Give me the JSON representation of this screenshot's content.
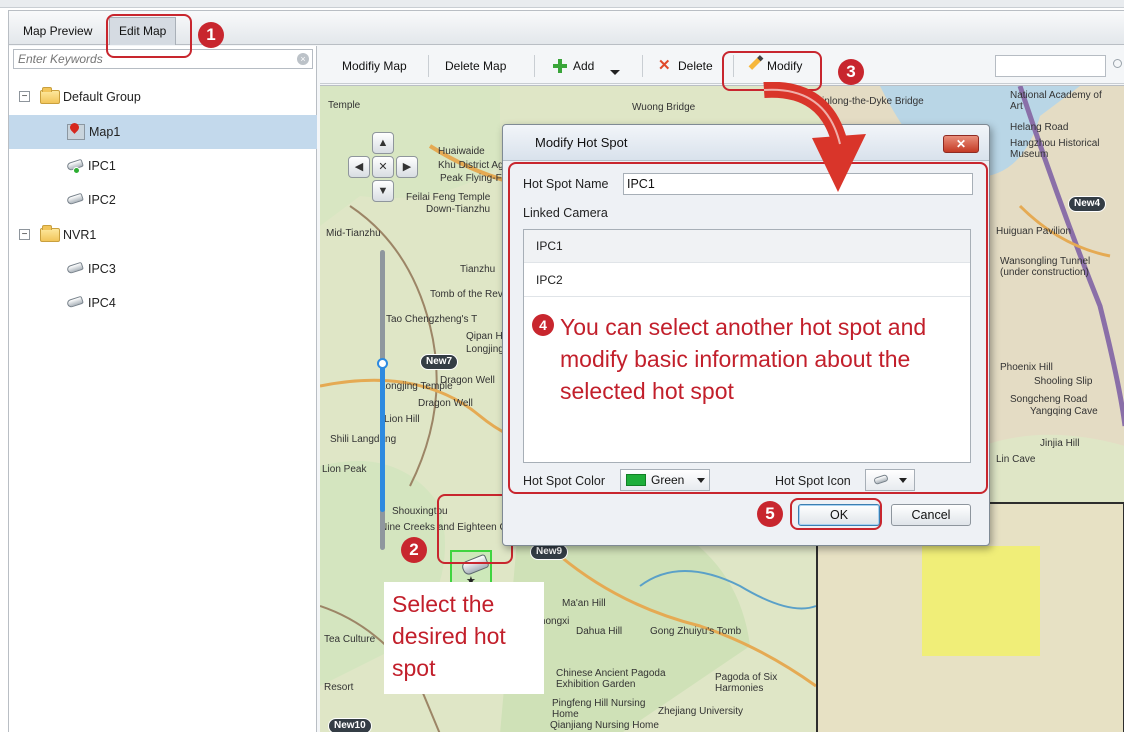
{
  "tabs": {
    "preview_label": "Map Preview",
    "edit_label": "Edit Map"
  },
  "search": {
    "placeholder": "Enter Keywords"
  },
  "tree": {
    "group_label": "Default Group",
    "map_label": "Map1",
    "ipc1_label": "IPC1",
    "ipc2_label": "IPC2",
    "nvr_label": "NVR1",
    "ipc3_label": "IPC3",
    "ipc4_label": "IPC4"
  },
  "toolbar": {
    "modify_map_label": "Modifiy Map",
    "delete_map_label": "Delete Map",
    "add_label": "Add",
    "delete_label": "Delete",
    "modify_label": "Modify"
  },
  "map": {
    "new_tag_1": "New7",
    "new_tag_2": "New9",
    "new_tag_3": "New4",
    "new_tag_4": "New10",
    "labels": {
      "l1": "Temple",
      "l2": "Wuong Bridge",
      "l3": "Jinlong-the-Dyke Bridge",
      "l4": "Huaiwaide",
      "l5": "Khu District Ag",
      "l6": "Peak Flying-F",
      "l7": "Feilai Feng Temple",
      "l8": "Down-Tianzhu",
      "l9": "Mid-Tianzhu",
      "l10": "Tianzhu",
      "l11": "Tomb of the Revolution M",
      "l12": "Tao Chengzheng's T",
      "l13": "Qipan H",
      "l14": "Longjing",
      "l15": "Longjing Temple",
      "l16": "Dragon Well",
      "l17": "Lion Hill",
      "l18": "Dragon Well",
      "l19": "Shili Langdang",
      "l20": "Lion Peak",
      "l21": "Shouxingtou",
      "l22": "Nine Creeks and Eighteen Gullies",
      "l23": "Ma'an Hill",
      "l24": "Xizhongxi",
      "l25": "Dahua Hill",
      "l26": "Gong Zhuiyu's Tomb",
      "l27": "Chinese Ancient Pagoda Exhibition Garden",
      "l28": "Pagoda of Six Harmonies",
      "l29": "Pingfeng Hill Nursing Home",
      "l30": "Zhejiang University",
      "l31": "Qianjiang Nursing Home",
      "l32": "National Academy of Art",
      "l33": "Helang Road",
      "l34": "Hangzhou Historical Museum",
      "l35": "Huiguan Pavilion",
      "l36": "Wansongling Tunnel (under construction)",
      "l37": "Phoenix Hill",
      "l38": "Shooling Slip",
      "l39": "Songcheng Road",
      "l40": "Yangqing Cave",
      "l41": "Jinjia Hill",
      "l42": "Lin Cave",
      "l43": "Tea Culture",
      "l44": "Resort"
    }
  },
  "dialog": {
    "title": "Modify Hot Spot",
    "close_label": "✕",
    "name_label": "Hot Spot Name",
    "name_value": "IPC1",
    "linked_label": "Linked Camera",
    "cameras": [
      "IPC1",
      "IPC2"
    ],
    "color_label": "Hot Spot Color",
    "color_value": "Green",
    "icon_label": "Hot Spot Icon",
    "ok_label": "OK",
    "cancel_label": "Cancel"
  },
  "annotations": {
    "step1": "1",
    "step2": "2",
    "step3": "3",
    "step4": "4",
    "step5": "5",
    "note_modify": "You can select another hot spot and modify basic information about the selected hot spot",
    "note_select": "Select the desired hot spot"
  },
  "colors": {
    "accent_red": "#c8262e",
    "selection_blue": "#c3d9ec",
    "hotspot_green": "#1fae3a"
  }
}
